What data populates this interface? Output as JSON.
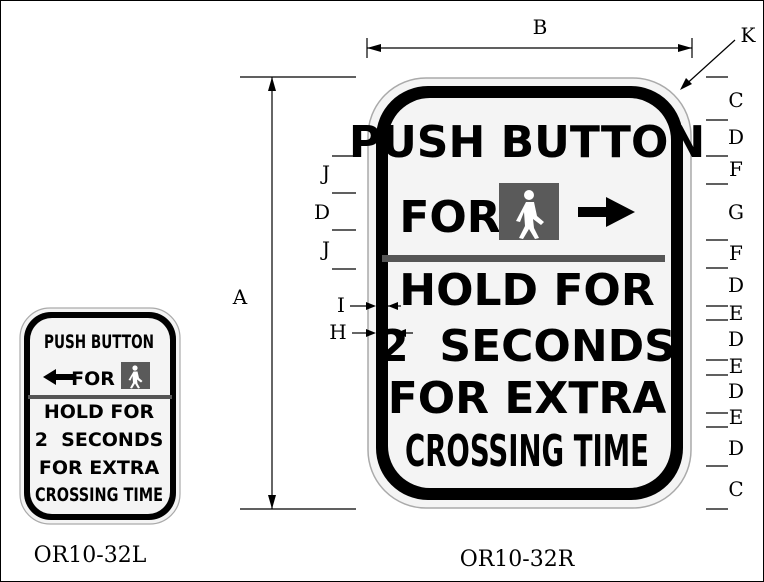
{
  "signs": {
    "large": {
      "line1": "PUSH BUTTON",
      "line2_for": "FOR",
      "line3": "HOLD FOR",
      "line4": "2  SECONDS",
      "line5": "FOR EXTRA",
      "line6": "CROSSING TIME",
      "label": "OR10-32R"
    },
    "small": {
      "line1": "PUSH BUTTON",
      "line2_for": "FOR",
      "line3": "HOLD FOR",
      "line4": "2  SECONDS",
      "line5": "FOR EXTRA",
      "line6": "CROSSING TIME",
      "label": "OR10-32L"
    }
  },
  "dimensions": {
    "A": "A",
    "B": "B",
    "K": "K",
    "H": "H",
    "I": "I",
    "left": [
      "J",
      "D",
      "J"
    ],
    "right": [
      "C",
      "D",
      "F",
      "G",
      "F",
      "D",
      "E",
      "D",
      "E",
      "D",
      "E",
      "D",
      "C"
    ]
  },
  "colors": {
    "sign_face": "#f4f4f4",
    "border": "#000000",
    "icon_bg": "#5a5a5a",
    "divider": "#555555"
  }
}
